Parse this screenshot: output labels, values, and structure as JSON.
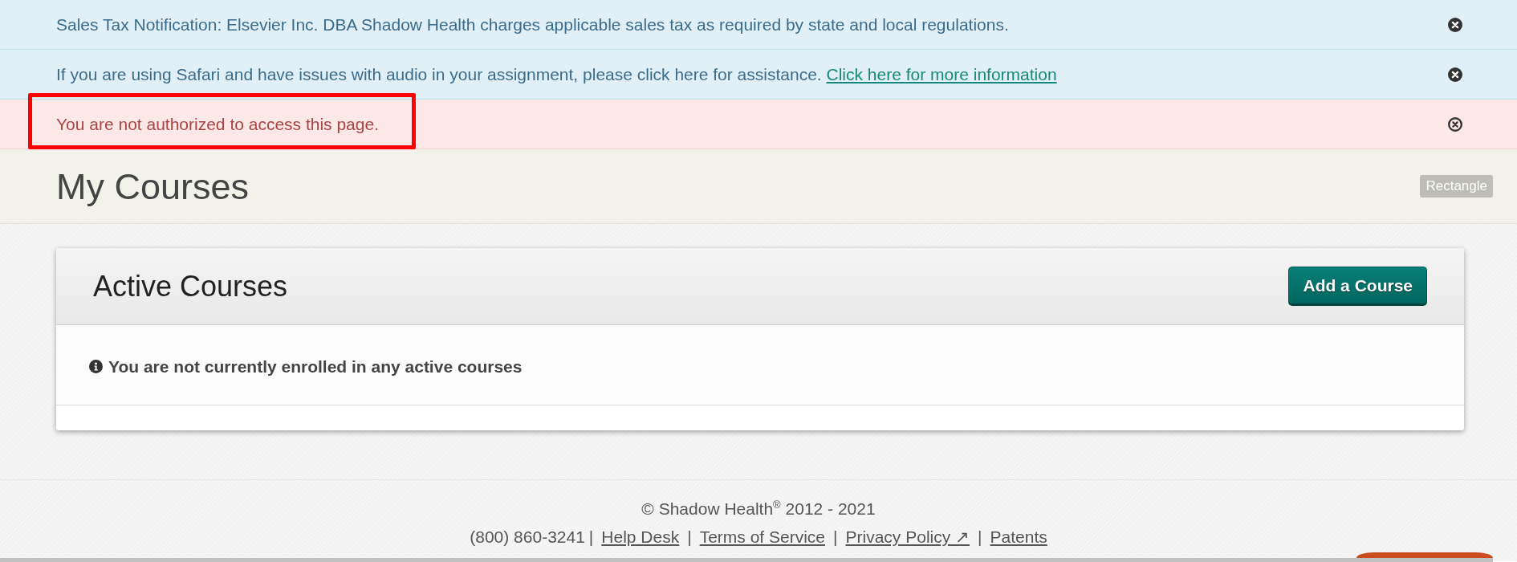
{
  "alerts": [
    {
      "kind": "info",
      "text": "Sales Tax Notification: Elsevier Inc. DBA Shadow Health charges applicable sales tax as required by state and local regulations.",
      "highlighted": false
    },
    {
      "kind": "info",
      "text": "If you are using Safari and have issues with audio in your assignment, please click here for assistance.",
      "link": "Click here for more information",
      "highlighted": false
    },
    {
      "kind": "danger",
      "text": "You are not authorized to access this page.",
      "highlighted": true
    }
  ],
  "header": {
    "title": "My Courses",
    "tag": "Rectangle"
  },
  "card": {
    "title": "Active Courses",
    "button": "Add a Course",
    "message": "You are not currently enrolled in any active courses"
  },
  "footer": {
    "copyright": "© Shadow Health$^{®}$ 2012 - 2021",
    "items": [
      {
        "kind": "phone",
        "text": "(800) 860-3241"
      },
      {
        "kind": "separator",
        "text": "|"
      },
      {
        "kind": "link",
        "text": "Help Desk"
      },
      {
        "kind": "separator",
        "text": "|"
      },
      {
        "kind": "link",
        "text": "Terms of Service"
      },
      {
        "kind": "separator",
        "text": "|"
      },
      {
        "kind": "link",
        "text": "Privacy Policy ↗"
      },
      {
        "kind": "separator",
        "text": "|"
      },
      {
        "kind": "link",
        "text": "Patents"
      }
    ]
  }
}
